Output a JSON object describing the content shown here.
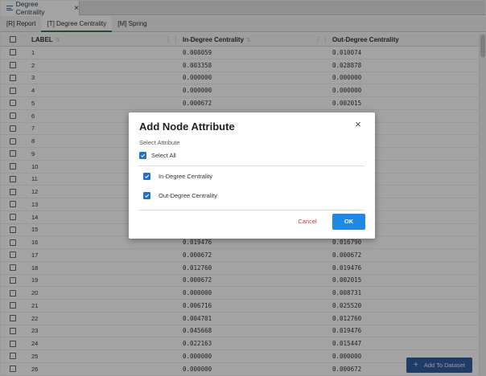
{
  "window_tab": {
    "title": "Degree Centrality",
    "icon": "list-icon",
    "close_glyph": "×"
  },
  "subtabs": [
    {
      "label": "[R] Report",
      "active": false
    },
    {
      "label": "[T] Degree Centrality",
      "active": true
    },
    {
      "label": "[M] Spring",
      "active": false
    }
  ],
  "table": {
    "columns": [
      "LABEL",
      "In-Degree Centrality",
      "Out-Degree Centrality"
    ],
    "rows": [
      [
        "1",
        "0.008059",
        "0.010074"
      ],
      [
        "2",
        "0.003358",
        "0.028878"
      ],
      [
        "3",
        "0.000000",
        "0.000000"
      ],
      [
        "4",
        "0.000000",
        "0.000000"
      ],
      [
        "5",
        "0.000672",
        "0.002015"
      ],
      [
        "6",
        "",
        ""
      ],
      [
        "7",
        "",
        ""
      ],
      [
        "8",
        "",
        ""
      ],
      [
        "9",
        "",
        ""
      ],
      [
        "10",
        "",
        ""
      ],
      [
        "11",
        "",
        ""
      ],
      [
        "12",
        "",
        ""
      ],
      [
        "13",
        "",
        ""
      ],
      [
        "14",
        "",
        ""
      ],
      [
        "15",
        "",
        ""
      ],
      [
        "16",
        "0.019476",
        "0.016790"
      ],
      [
        "17",
        "0.000672",
        "0.000672"
      ],
      [
        "18",
        "0.012760",
        "0.019476"
      ],
      [
        "19",
        "0.000672",
        "0.002015"
      ],
      [
        "20",
        "0.000000",
        "0.008731"
      ],
      [
        "21",
        "0.006716",
        "0.025520"
      ],
      [
        "22",
        "0.004701",
        "0.012760"
      ],
      [
        "23",
        "0.045668",
        "0.019476"
      ],
      [
        "24",
        "0.022163",
        "0.015447"
      ],
      [
        "25",
        "0.000000",
        "0.000000"
      ],
      [
        "26",
        "0.000000",
        "0.000672"
      ]
    ]
  },
  "dialog": {
    "title": "Add Node Attribute",
    "close_glyph": "×",
    "subtitle": "Select Attribute",
    "select_all_label": "Select All",
    "options": [
      {
        "label": "In-Degree Centrality",
        "checked": true
      },
      {
        "label": "Out-Degree Centrality",
        "checked": true
      }
    ],
    "cancel_label": "Cancel",
    "ok_label": "OK"
  },
  "fab": {
    "label": "Add To Dataset",
    "icon": "plus-icon",
    "glyph": "+"
  },
  "colors": {
    "primary": "#1e88e5",
    "cancel": "#d0342c",
    "fab": "#2f5f9e",
    "active_tab": "#2f7d4a"
  }
}
